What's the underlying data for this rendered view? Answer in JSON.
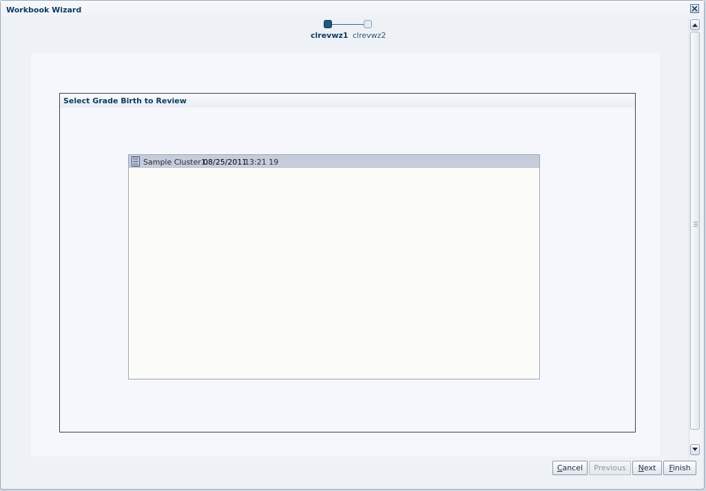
{
  "window": {
    "title": "Workbook Wizard"
  },
  "train": {
    "steps": [
      {
        "label": "clrevwz1",
        "state": "current"
      },
      {
        "label": "clrevwz2",
        "state": "next"
      }
    ]
  },
  "section": {
    "title": "Select Grade Birth to Review"
  },
  "list": {
    "items": [
      {
        "name": "Sample Cluster1:",
        "date": "08/25/2011",
        "time": "13:21 19",
        "selected": true
      }
    ]
  },
  "buttons": {
    "cancel": {
      "first": "C",
      "rest": "ancel"
    },
    "previous": {
      "label": "Previous",
      "enabled": false
    },
    "next": {
      "first": "N",
      "rest": "ext"
    },
    "finish": {
      "first": "F",
      "rest": "inish"
    }
  },
  "colors": {
    "accent": "#0c3a5c",
    "selected_row": "#c6ccdc",
    "list_background": "#fbfcf7"
  }
}
